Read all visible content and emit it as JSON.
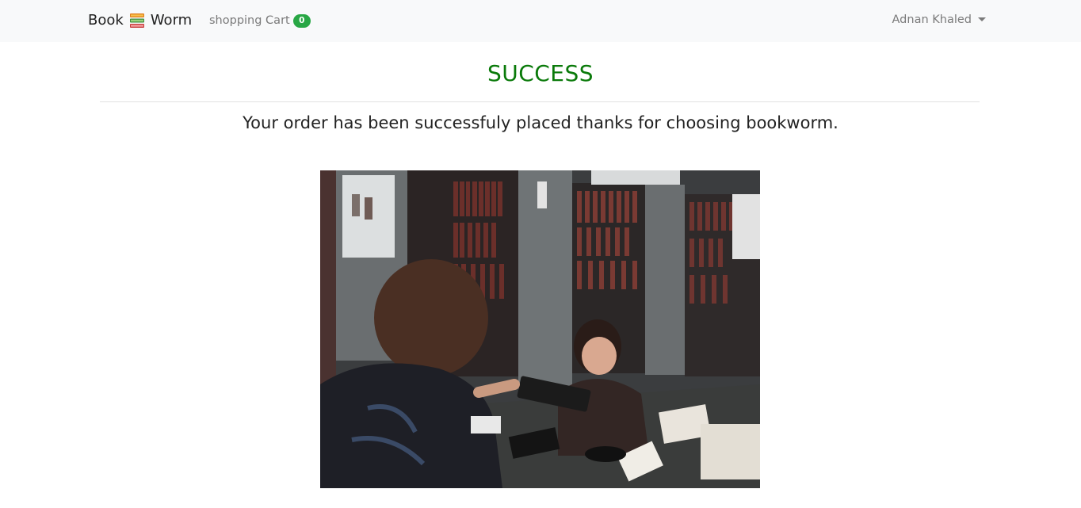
{
  "navbar": {
    "brand_left": "Book",
    "brand_right": "Worm",
    "brand_icon": "books-icon",
    "cart_label": "shopping Cart",
    "cart_count": "0",
    "user_name": "Adnan Khaled"
  },
  "main": {
    "title": "SUCCESS",
    "message": "Your order has been successfuly placed thanks for choosing bookworm.",
    "image_subject": "library-photo"
  },
  "colors": {
    "title_green": "#0a7a0a",
    "badge_green": "#28a745",
    "navbar_bg": "#f8f9fa"
  }
}
